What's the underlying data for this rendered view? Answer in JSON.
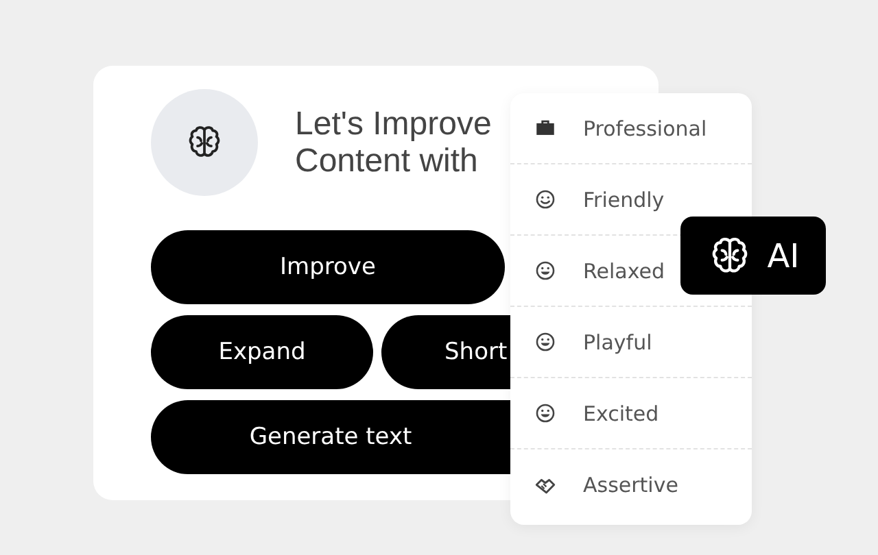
{
  "card": {
    "heading_lines": [
      "Let's Improve",
      "Content with"
    ],
    "buttons": [
      {
        "label": "Improve",
        "kind": "wide"
      },
      {
        "label": "Expand",
        "kind": "half"
      },
      {
        "label": "Short",
        "kind": "half-cut"
      },
      {
        "label": "Generate text",
        "kind": "wide-cut"
      }
    ]
  },
  "tone_menu": [
    {
      "label": "Professional",
      "kind": "briefcase"
    },
    {
      "label": "Friendly",
      "kind": "smile"
    },
    {
      "label": "Relaxed",
      "kind": "grin"
    },
    {
      "label": "Playful",
      "kind": "grin"
    },
    {
      "label": "Excited",
      "kind": "grin"
    },
    {
      "label": "Assertive",
      "kind": "handshake"
    }
  ],
  "ai_badge": {
    "label": "AI"
  }
}
